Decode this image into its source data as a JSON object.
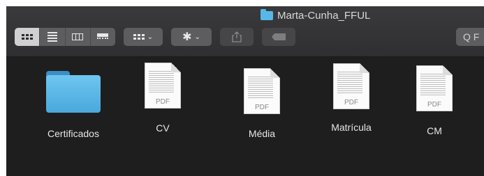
{
  "window": {
    "title": "Marta-Cunha_FFUL",
    "title_icon": "folder-icon"
  },
  "toolbar": {
    "view_buttons": [
      {
        "name": "icon-view",
        "icon": "grid-icon",
        "selected": true
      },
      {
        "name": "list-view",
        "icon": "list-icon",
        "selected": false
      },
      {
        "name": "column-view",
        "icon": "columns-icon",
        "selected": false
      },
      {
        "name": "gallery-view",
        "icon": "gallery-icon",
        "selected": false
      }
    ],
    "group_icon": "group-grid-icon",
    "action_icon": "gear-icon",
    "share_icon": "share-icon",
    "tag_icon": "tag-icon",
    "chevron": "⌄",
    "search_placeholder": "Q F"
  },
  "items": [
    {
      "name": "Certificados",
      "kind": "folder"
    },
    {
      "name": "CV",
      "kind": "pdf",
      "badge": "PDF"
    },
    {
      "name": "Média",
      "kind": "pdf",
      "badge": "PDF"
    },
    {
      "name": "Matrícula",
      "kind": "pdf",
      "badge": "PDF"
    },
    {
      "name": "CM",
      "kind": "pdf",
      "badge": "PDF"
    }
  ],
  "colors": {
    "folder": "#5bb6e8",
    "toolbar_bg": "#3a3a3c",
    "content_bg": "#1e1e1e"
  }
}
